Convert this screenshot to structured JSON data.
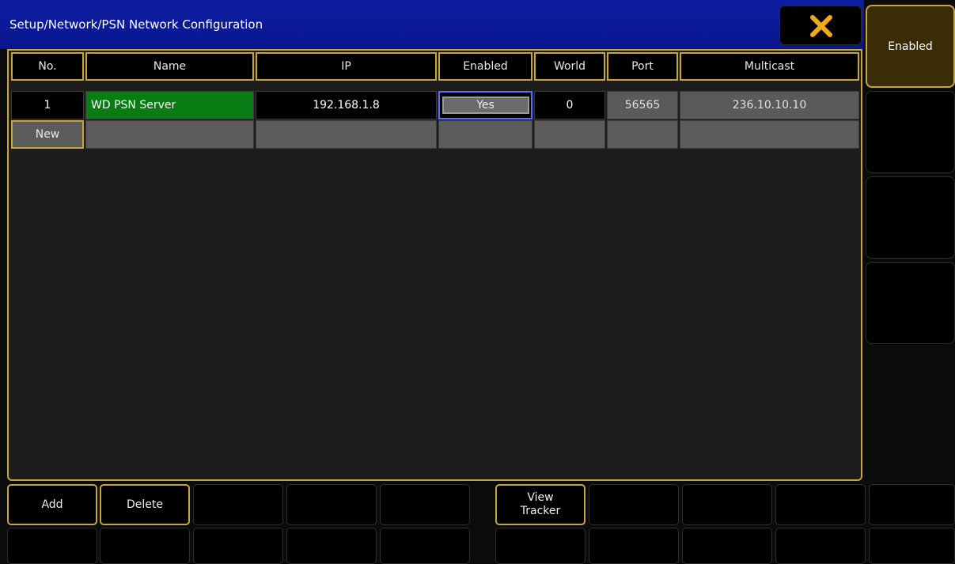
{
  "window": {
    "title": "Setup/Network/PSN Network Configuration",
    "close_icon": "close-x-icon"
  },
  "side_panel": {
    "enabled_label": "Enabled"
  },
  "table": {
    "headers": [
      "No.",
      "Name",
      "IP",
      "Enabled",
      "World",
      "Port",
      "Multicast"
    ],
    "rows": [
      {
        "no": "1",
        "name": "WD PSN Server",
        "ip": "192.168.1.8",
        "enabled": "Yes",
        "world": "0",
        "port": "56565",
        "multicast": "236.10.10.10"
      }
    ],
    "new_row_label": "New"
  },
  "toolbar": {
    "add_label": "Add",
    "delete_label": "Delete",
    "view_tracker_label": "View\nTracker"
  },
  "colors": {
    "accent": "#c9a43a",
    "title_bar": "#0a1690",
    "name_cell": "#0a7c14",
    "focus": "#5c6cff"
  }
}
